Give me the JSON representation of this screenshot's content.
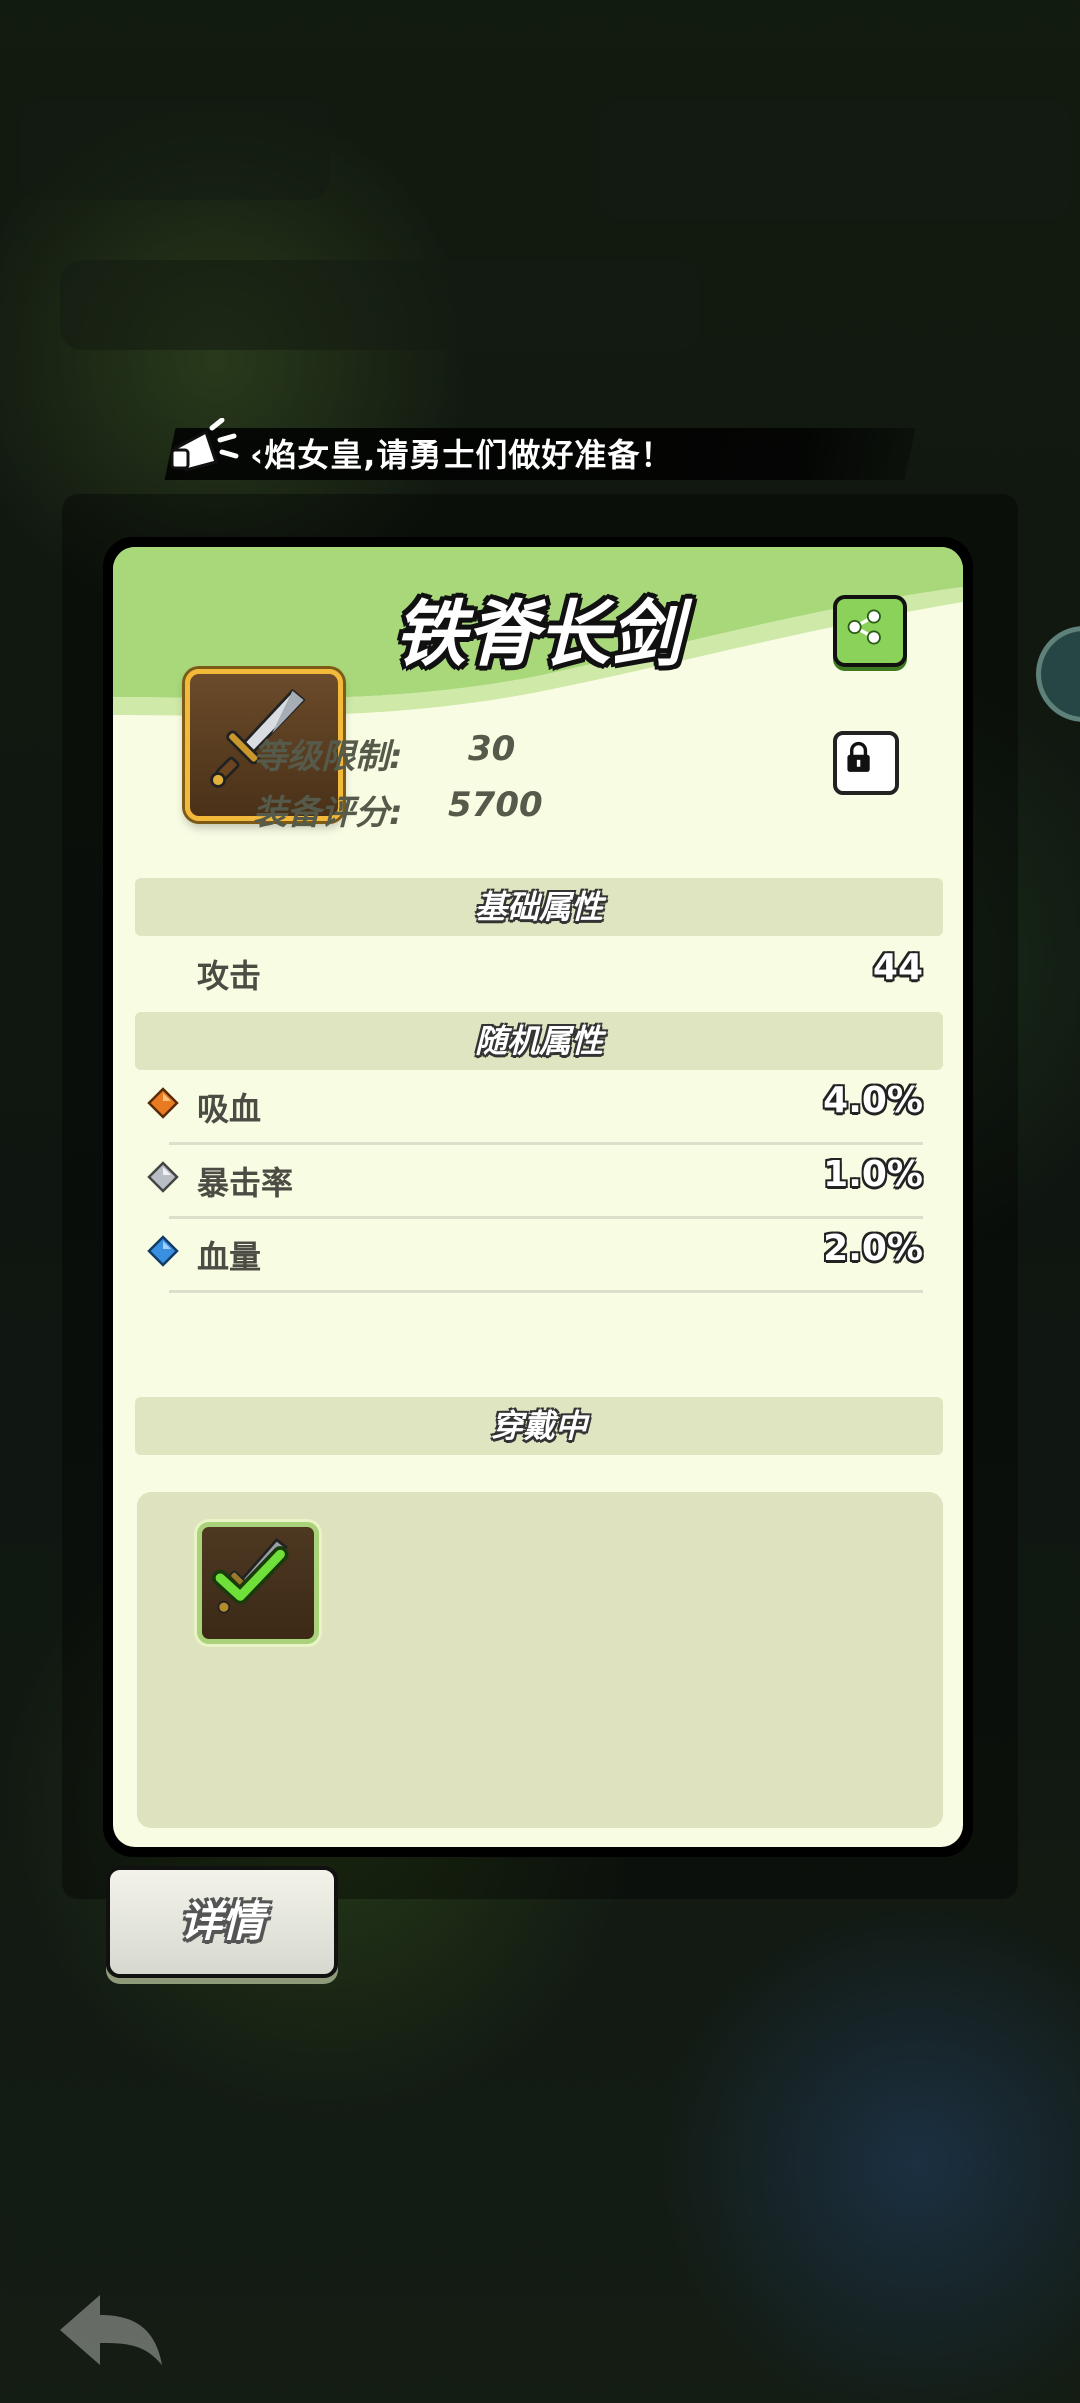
{
  "announcement": {
    "text": "‹焰女皇,请勇士们做好准备！"
  },
  "item": {
    "name": "铁脊长剑",
    "level_limit_label": "等级限制:",
    "level_limit_value": "30",
    "score_label": "装备评分:",
    "score_value": "5700"
  },
  "sections": {
    "base_title": "基础属性",
    "random_title": "随机属性",
    "equipped_title": "穿戴中"
  },
  "base_attributes": [
    {
      "label": "攻击",
      "value": "44"
    }
  ],
  "random_attributes": [
    {
      "label": "吸血",
      "value": "4.0%",
      "gem": "orange-gem-icon",
      "color": "#e87a22"
    },
    {
      "label": "暴击率",
      "value": "1.0%",
      "gem": "silver-gem-icon",
      "color": "#b9bdc4"
    },
    {
      "label": "血量",
      "value": "2.0%",
      "gem": "blue-gem-icon",
      "color": "#3a8fe0"
    }
  ],
  "buttons": {
    "detail_label": "详情"
  },
  "colors": {
    "panel_bg": "#f8fce3",
    "header_green": "#a8d87a",
    "gold_border": "#f2b93a",
    "equipped_border": "#a9d27a"
  }
}
